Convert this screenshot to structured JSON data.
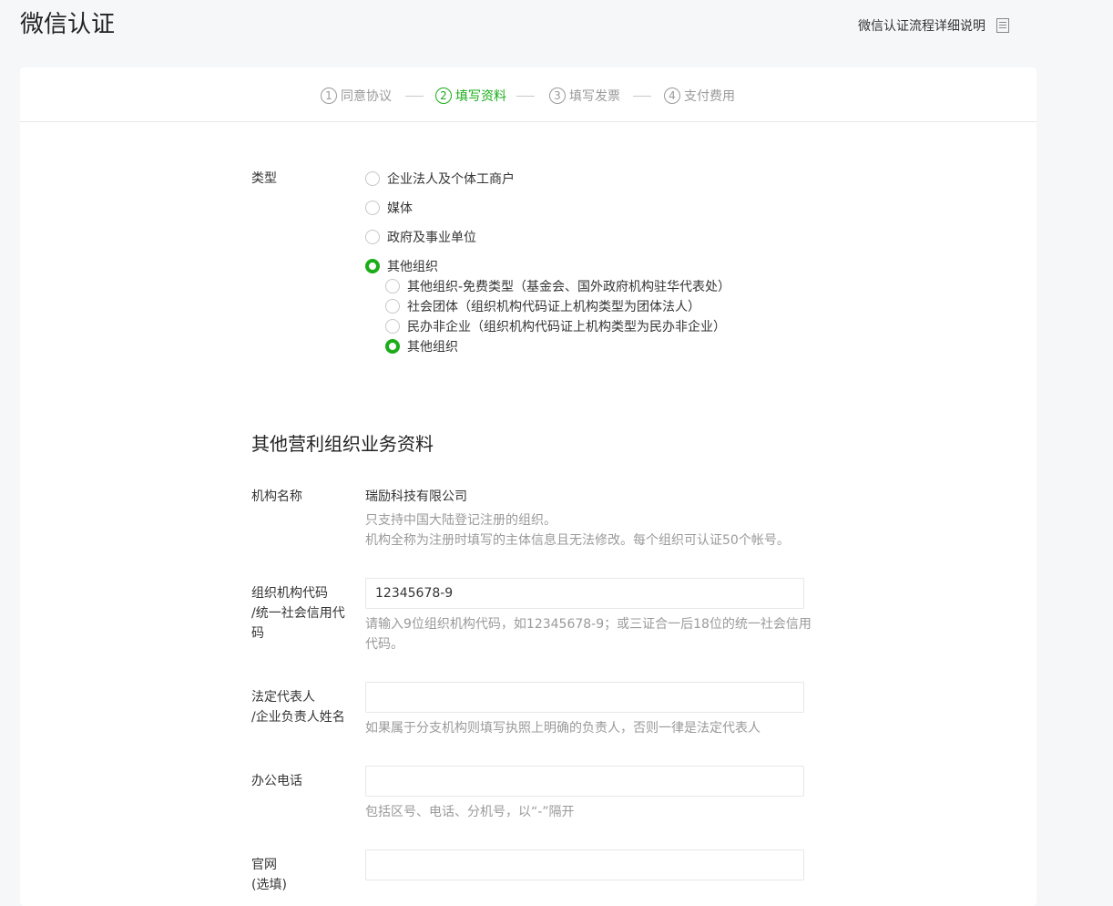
{
  "header": {
    "title": "微信认证",
    "help_link": "微信认证流程详细说明",
    "help_icon": "document-icon"
  },
  "steps": [
    {
      "num": "1",
      "label": "同意协议",
      "active": false
    },
    {
      "num": "2",
      "label": "填写资料",
      "active": true
    },
    {
      "num": "3",
      "label": "填写发票",
      "active": false
    },
    {
      "num": "4",
      "label": "支付费用",
      "active": false
    }
  ],
  "type_section": {
    "label": "类型",
    "options": [
      {
        "label": "企业法人及个体工商户",
        "checked": false
      },
      {
        "label": "媒体",
        "checked": false
      },
      {
        "label": "政府及事业单位",
        "checked": false
      },
      {
        "label": "其他组织",
        "checked": true
      }
    ],
    "sub_options": [
      {
        "label": "其他组织-免费类型（基金会、国外政府机构驻华代表处）",
        "checked": false
      },
      {
        "label": "社会团体（组织机构代码证上机构类型为团体法人）",
        "checked": false
      },
      {
        "label": "民办非企业（组织机构代码证上机构类型为民办非企业）",
        "checked": false
      },
      {
        "label": "其他组织",
        "checked": true
      }
    ]
  },
  "business_section": {
    "title": "其他营利组织业务资料",
    "org_name": {
      "label": "机构名称",
      "value": "瑞励科技有限公司",
      "hint_line1": "只支持中国大陆登记注册的组织。",
      "hint_line2": "机构全称为注册时填写的主体信息且无法修改。每个组织可认证50个帐号。"
    },
    "org_code": {
      "label_line1": "组织机构代码",
      "label_line2": "/统一社会信用代",
      "label_line3": "码",
      "value": "12345678-9",
      "hint": "请输入9位组织机构代码，如12345678-9；或三证合一后18位的统一社会信用代码。"
    },
    "legal_rep": {
      "label_line1": "法定代表人",
      "label_line2": "/企业负责人姓名",
      "value": "",
      "hint": "如果属于分支机构则填写执照上明确的负责人，否则一律是法定代表人"
    },
    "phone": {
      "label": "办公电话",
      "value": "",
      "hint": "包括区号、电话、分机号，以“-”隔开"
    },
    "website": {
      "label_line1": "官网",
      "label_line2": "(选填)",
      "value": ""
    }
  },
  "colors": {
    "accent": "#1aad19",
    "muted": "#9a9a9a",
    "background": "#f6f7f9"
  }
}
